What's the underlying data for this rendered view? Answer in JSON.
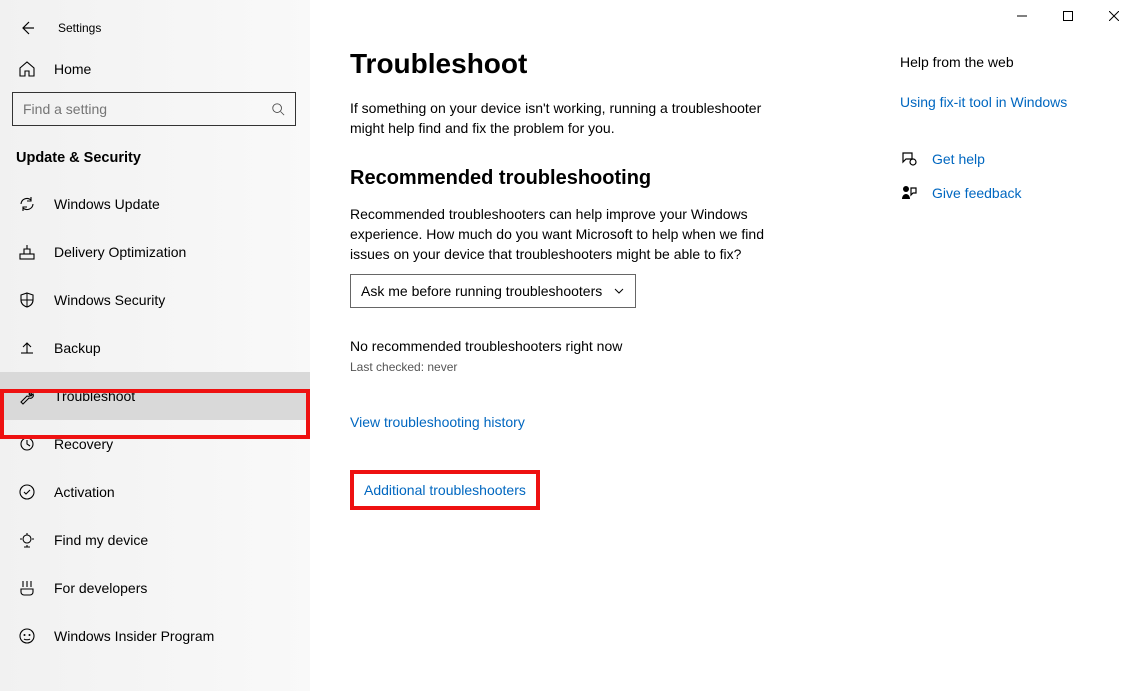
{
  "app": {
    "title": "Settings"
  },
  "sidebar": {
    "home_label": "Home",
    "search_placeholder": "Find a setting",
    "section_title": "Update & Security",
    "items": [
      {
        "label": "Windows Update"
      },
      {
        "label": "Delivery Optimization"
      },
      {
        "label": "Windows Security"
      },
      {
        "label": "Backup"
      },
      {
        "label": "Troubleshoot"
      },
      {
        "label": "Recovery"
      },
      {
        "label": "Activation"
      },
      {
        "label": "Find my device"
      },
      {
        "label": "For developers"
      },
      {
        "label": "Windows Insider Program"
      }
    ]
  },
  "main": {
    "title": "Troubleshoot",
    "intro": "If something on your device isn't working, running a troubleshooter might help find and fix the problem for you.",
    "rec_heading": "Recommended troubleshooting",
    "rec_text": "Recommended troubleshooters can help improve your Windows experience. How much do you want Microsoft to help when we find issues on your device that troubleshooters might be able to fix?",
    "dropdown_value": "Ask me before running troubleshooters",
    "no_rec": "No recommended troubleshooters right now",
    "last_checked": "Last checked: never",
    "history_link": "View troubleshooting history",
    "additional_link": "Additional troubleshooters"
  },
  "side": {
    "help_heading": "Help from the web",
    "fixit_link": "Using fix-it tool in Windows",
    "get_help": "Get help",
    "give_feedback": "Give feedback"
  }
}
